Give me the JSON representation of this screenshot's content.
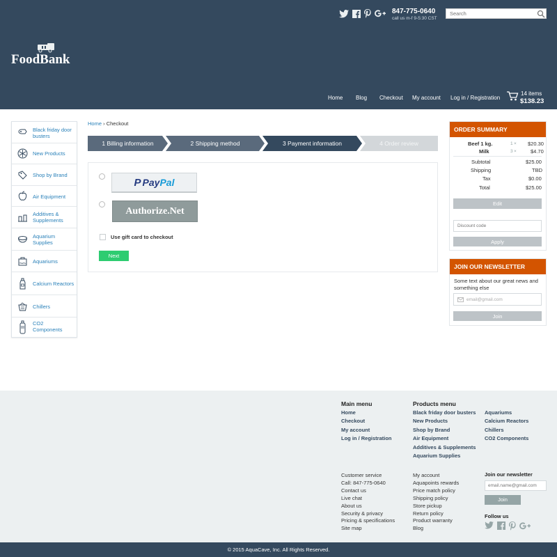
{
  "header": {
    "social": [
      "twitter-icon",
      "facebook-icon",
      "pinterest-icon",
      "google-plus-icon"
    ],
    "phone": "847-775-0640",
    "hours": "call us m-f 9-5:30 CST",
    "search_placeholder": "Search",
    "logo": "FoodBank",
    "nav": [
      "Home",
      "Blog",
      "Checkout",
      "My account",
      "Log in / Registration"
    ],
    "cart_items": "14 items",
    "cart_total": "$138.23"
  },
  "sidebar": {
    "items": [
      {
        "label": "Black friday door busters",
        "icon": "tag-icon"
      },
      {
        "label": "New Products",
        "icon": "snowflake-icon"
      },
      {
        "label": "Shop by Brand",
        "icon": "label-icon"
      },
      {
        "label": "Air Equipment",
        "icon": "apple-icon"
      },
      {
        "label": "Additives & Supplements",
        "icon": "bottles-icon"
      },
      {
        "label": "Aquarium Supplies",
        "icon": "bowl-icon"
      },
      {
        "label": "Aquariums",
        "icon": "tank-icon"
      },
      {
        "label": "Calcium Reactors",
        "icon": "bottle-icon"
      },
      {
        "label": "Chillers",
        "icon": "basket-icon"
      },
      {
        "label": "CO2 Components",
        "icon": "cylinder-icon"
      }
    ]
  },
  "breadcrumb": {
    "home": "Home",
    "sep": "›",
    "current": "Checkout"
  },
  "steps": [
    "1 Billing information",
    "2 Shipping method",
    "3 Payment information",
    "4 Order review"
  ],
  "payment": {
    "paypal_part1": "Pay",
    "paypal_part2": "Pal",
    "authorize": "Authorize.Net",
    "gift_label": "Use gift card to checkout",
    "next": "Next"
  },
  "summary": {
    "title": "ORDER SUMMARY",
    "items": [
      {
        "name": "Beef 1 kg.",
        "qty": "1",
        "x": "×",
        "price": "$20.30"
      },
      {
        "name": "Milk",
        "qty": "3",
        "x": "×",
        "price": "$4.70"
      }
    ],
    "totals": [
      {
        "label": "Subtotal",
        "value": "$25.00"
      },
      {
        "label": "Shipping",
        "value": "TBD"
      },
      {
        "label": "Tax",
        "value": "$0.00"
      },
      {
        "label": "Total",
        "value": "$25.00"
      }
    ],
    "edit": "Edit",
    "discount_placeholder": "Discount code",
    "apply": "Apply"
  },
  "newsletter": {
    "title": "JOIN OUR NEWSLETTER",
    "text": "Some text about our great news and something else",
    "placeholder": "email@gmail.com",
    "join": "Join"
  },
  "footer": {
    "main_title": "Main menu",
    "main": [
      "Home",
      "Checkout",
      "My account",
      "Log in / Registration"
    ],
    "products_title": "Products menu",
    "products_col1": [
      "Black friday door busters",
      "New Products",
      "Shop by Brand",
      "Air Equipment",
      "Additives & Supplements",
      "Aquarium Supplies"
    ],
    "products_col2": [
      "Aquariums",
      "Calcium Reactors",
      "Chillers",
      "CO2 Components"
    ],
    "service": [
      "Customer service",
      "Call: 847-775-0640",
      "Contact us",
      "Live chat",
      "About us",
      "Security & privacy",
      "Pricing & specifications",
      "Site map"
    ],
    "account": [
      "My account",
      "Aquapoints rewards",
      "Price match policy",
      "Shipping policy",
      "Store pickup",
      "Return policy",
      "Product warranty",
      "Blog"
    ],
    "newsletter_title": "Join our newsletter",
    "newsletter_placeholder": "email.name@gmail.com",
    "join": "Join",
    "follow": "Follow us",
    "copyright": "© 2015 AquaCave, Inc. All Rights Reserved."
  }
}
